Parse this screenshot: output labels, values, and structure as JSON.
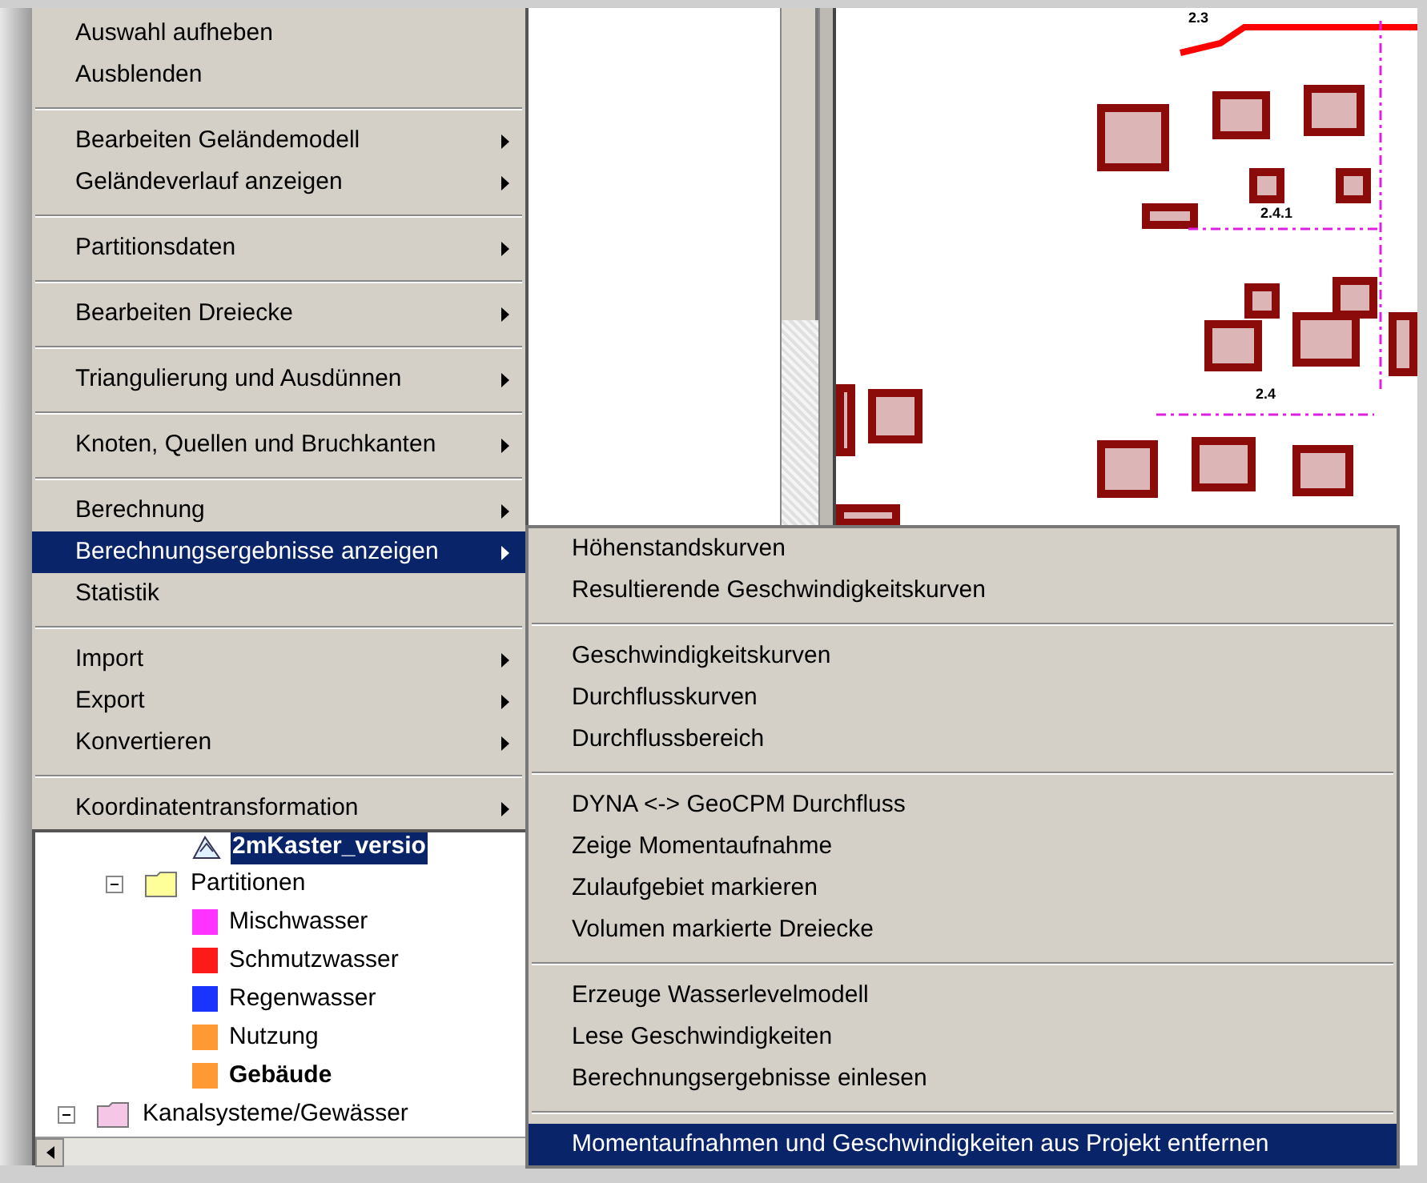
{
  "context_menu": {
    "groups": [
      [
        {
          "label": "Auswahl aufheben",
          "submenu": false,
          "selected": false
        },
        {
          "label": "Ausblenden",
          "submenu": false,
          "selected": false
        }
      ],
      [
        {
          "label": "Bearbeiten Geländemodell",
          "submenu": true,
          "selected": false
        },
        {
          "label": "Geländeverlauf anzeigen",
          "submenu": true,
          "selected": false
        }
      ],
      [
        {
          "label": "Partitionsdaten",
          "submenu": true,
          "selected": false
        }
      ],
      [
        {
          "label": "Bearbeiten Dreiecke",
          "submenu": true,
          "selected": false
        }
      ],
      [
        {
          "label": "Triangulierung und Ausdünnen",
          "submenu": true,
          "selected": false
        }
      ],
      [
        {
          "label": "Knoten, Quellen und Bruchkanten",
          "submenu": true,
          "selected": false
        }
      ],
      [
        {
          "label": "Berechnung",
          "submenu": true,
          "selected": false
        },
        {
          "label": "Berechnungsergebnisse anzeigen",
          "submenu": true,
          "selected": true
        },
        {
          "label": "Statistik",
          "submenu": false,
          "selected": false
        }
      ],
      [
        {
          "label": "Import",
          "submenu": true,
          "selected": false
        },
        {
          "label": "Export",
          "submenu": true,
          "selected": false
        },
        {
          "label": "Konvertieren",
          "submenu": true,
          "selected": false
        }
      ],
      [
        {
          "label": "Koordinatentransformation",
          "submenu": true,
          "selected": false
        }
      ]
    ]
  },
  "submenu": {
    "groups": [
      [
        {
          "label": "Höhenstandskurven",
          "selected": false
        },
        {
          "label": "Resultierende Geschwindigkeitskurven",
          "selected": false
        }
      ],
      [
        {
          "label": "Geschwindigkeitskurven",
          "selected": false
        },
        {
          "label": "Durchflusskurven",
          "selected": false
        },
        {
          "label": "Durchflussbereich",
          "selected": false
        }
      ],
      [
        {
          "label": "DYNA <-> GeoCPM Durchfluss",
          "selected": false
        },
        {
          "label": "Zeige Momentaufnahme",
          "selected": false
        },
        {
          "label": "Zulaufgebiet markieren",
          "selected": false
        },
        {
          "label": "Volumen markierte Dreiecke",
          "selected": false
        }
      ],
      [
        {
          "label": "Erzeuge Wasserlevelmodell",
          "selected": false
        },
        {
          "label": "Lese Geschwindigkeiten",
          "selected": false
        },
        {
          "label": "Berechnungsergebnisse einlesen",
          "selected": false
        }
      ],
      [
        {
          "label": "Momentaufnahmen und Geschwindigkeiten aus Projekt entfernen",
          "selected": true
        }
      ]
    ]
  },
  "tree": [
    {
      "children": [
        {
          "children": [
            {
              "kind": "raster",
              "label": "2mKaster_versio",
              "selected": true,
              "bold": true
            }
          ]
        },
        {
          "kind": "folder",
          "label": "Partitionen",
          "color": "#ffff99",
          "expanded": true,
          "selected": false,
          "bold": false,
          "children": [
            {
              "kind": "partition",
              "label": "Mischwasser",
              "color": "#ff33ff",
              "selected": false,
              "bold": false
            },
            {
              "kind": "partition",
              "label": "Schmutzwasser",
              "color": "#ff1a1a",
              "selected": false,
              "bold": false
            },
            {
              "kind": "partition",
              "label": "Regenwasser",
              "color": "#1a33ff",
              "selected": false,
              "bold": false
            },
            {
              "kind": "partition",
              "label": "Nutzung",
              "color": "#ff9933",
              "selected": false,
              "bold": false
            },
            {
              "kind": "partition",
              "label": "Gebäude",
              "color": "#ff9933",
              "selected": false,
              "bold": true
            }
          ]
        }
      ]
    },
    {
      "kind": "folder",
      "label": "Kanalsysteme/Gewässer",
      "color": "#f5c6e6",
      "expanded": true,
      "selected": false,
      "bold": false
    }
  ],
  "map": {
    "labels": [
      "2.3",
      "2.4.1",
      "2.4"
    ]
  }
}
